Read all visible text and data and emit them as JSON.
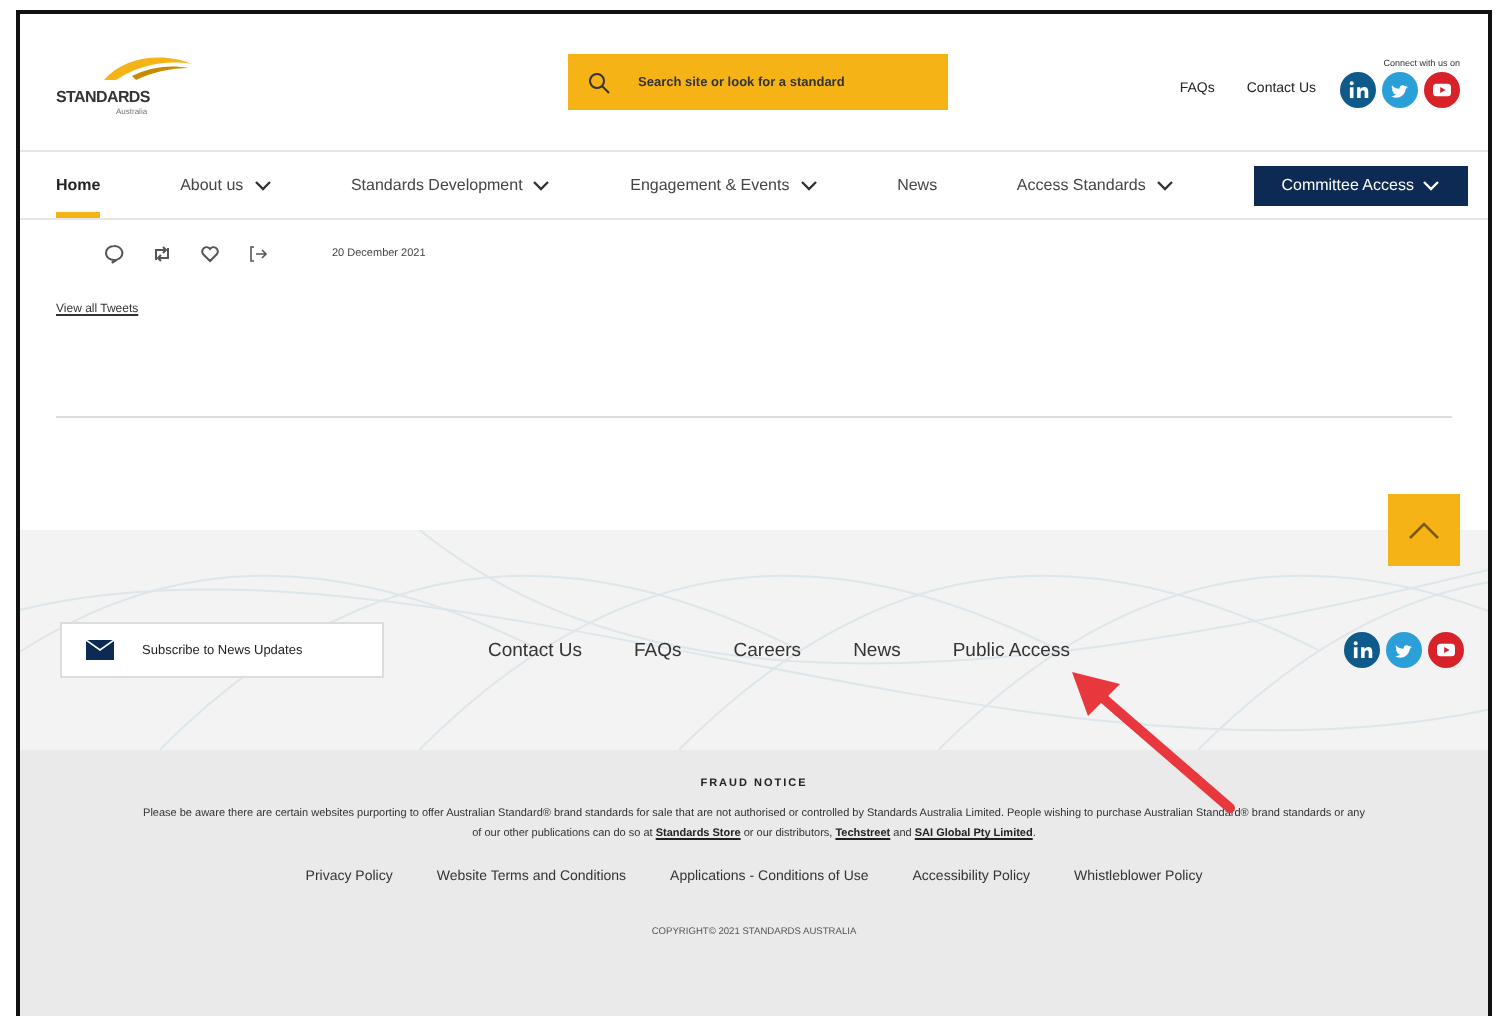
{
  "header": {
    "logo": {
      "name": "STANDARDS",
      "sub": "Australia"
    },
    "search": {
      "placeholder": "Search site or look for a standard"
    },
    "links": [
      "FAQs",
      "Contact Us"
    ],
    "social_caption": "Connect with us on"
  },
  "nav": {
    "items": [
      {
        "label": "Home",
        "selected": true,
        "dropdown": false
      },
      {
        "label": "About us",
        "selected": false,
        "dropdown": true
      },
      {
        "label": "Standards Development",
        "selected": false,
        "dropdown": true
      },
      {
        "label": "Engagement & Events",
        "selected": false,
        "dropdown": true
      },
      {
        "label": "News",
        "selected": false,
        "dropdown": false
      },
      {
        "label": "Access Standards",
        "selected": false,
        "dropdown": true
      }
    ],
    "cta": "Committee Access"
  },
  "tweet": {
    "date": "20 December 2021",
    "view_all": "View all Tweets"
  },
  "footer": {
    "subscribe": "Subscribe to News Updates",
    "links": [
      "Contact Us",
      "FAQs",
      "Careers",
      "News",
      "Public Access"
    ]
  },
  "fraud_notice": {
    "title": "FRAUD NOTICE",
    "segments": [
      {
        "text": "Please be aware there are certain websites purporting to offer Australian Standard® brand standards for sale that are not authorised or controlled by Standards Australia Limited. People wishing to purchase Australian Standard® brand standards or any of our other publications can do so at ",
        "link": false
      },
      {
        "text": "Standards Store",
        "link": true
      },
      {
        "text": " or our distributors, ",
        "link": false
      },
      {
        "text": "Techstreet",
        "link": true
      },
      {
        "text": " and ",
        "link": false
      },
      {
        "text": "SAI Global Pty Limited",
        "link": true
      },
      {
        "text": ".",
        "link": false
      }
    ]
  },
  "policies": [
    "Privacy Policy",
    "Website Terms and Conditions",
    "Applications - Conditions of Use",
    "Accessibility Policy",
    "Whistleblower Policy"
  ],
  "copyright": "COPYRIGHT© 2021 STANDARDS AUSTRALIA"
}
